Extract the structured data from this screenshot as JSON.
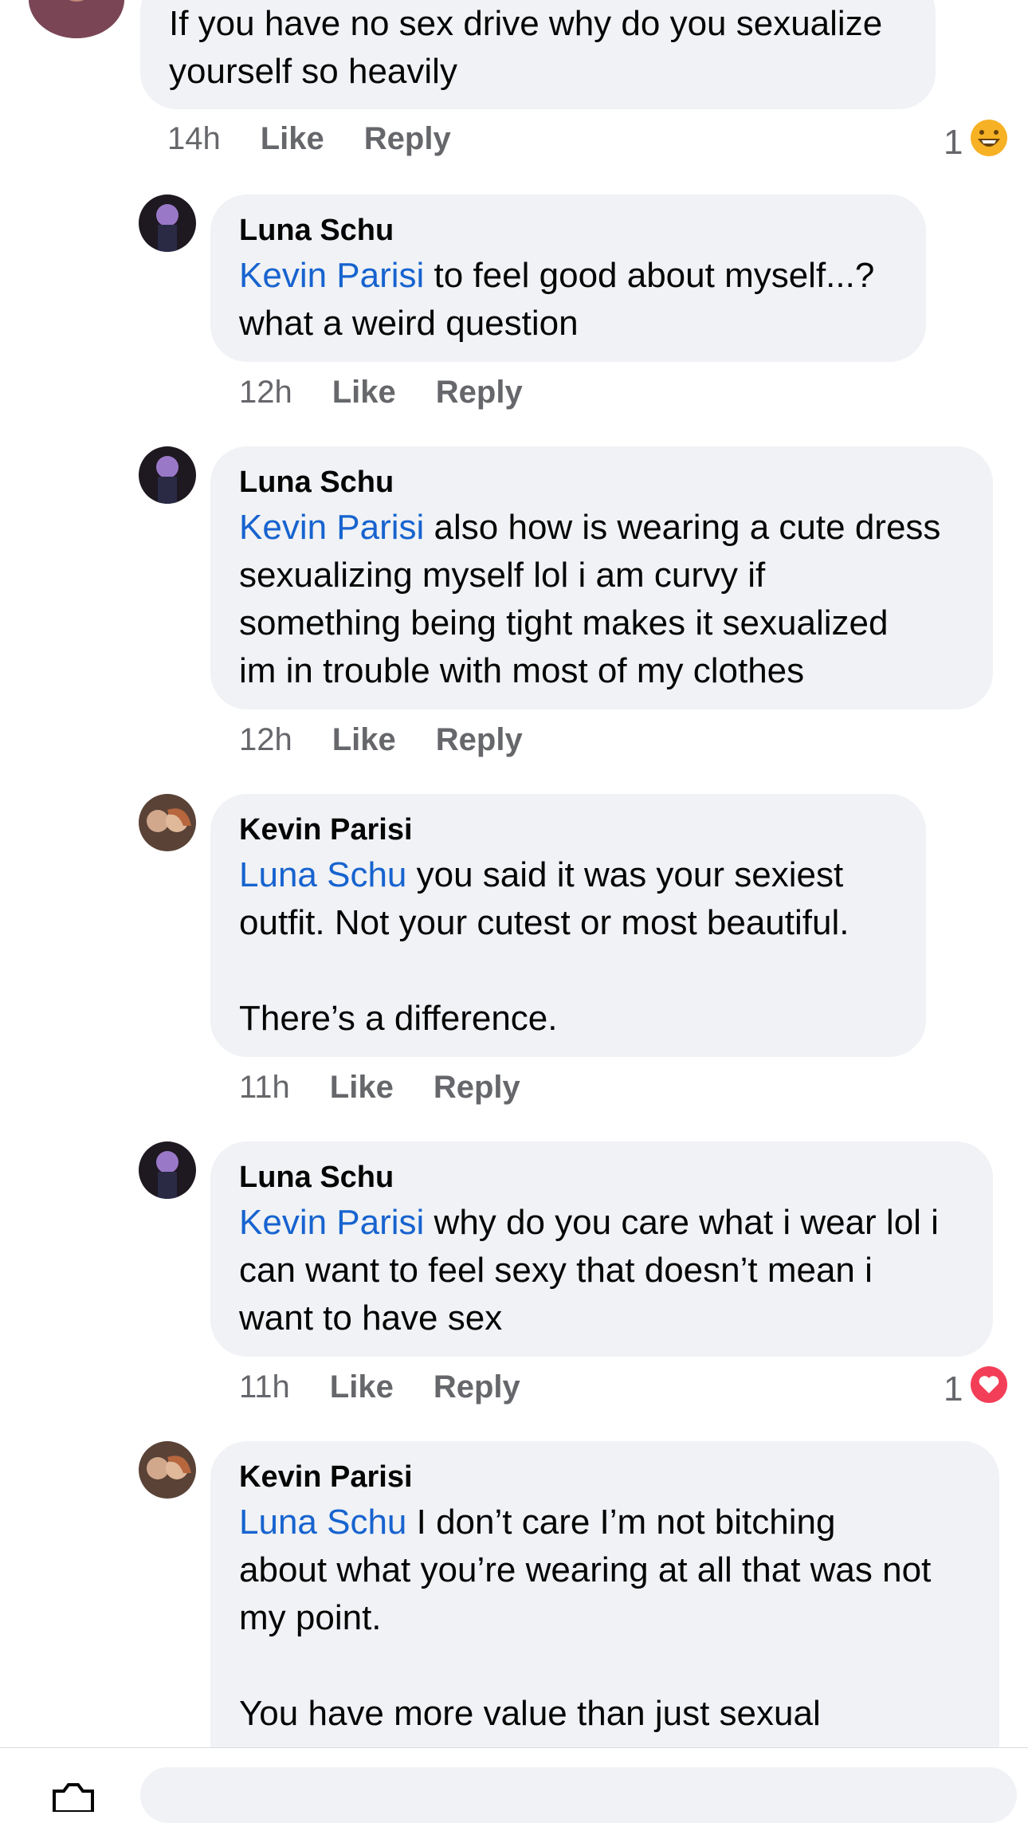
{
  "comments": [
    {
      "body": "If you have no sex drive why do you sexualize yourself so heavily",
      "time": "14h",
      "like": "Like",
      "reply": "Reply",
      "reaction_count": "1",
      "reaction_icon": "haha-icon"
    },
    {
      "author": "Luna Schu",
      "mention": "Kevin Parisi",
      "body": " to feel good about myself...?\nwhat a weird question",
      "time": "12h",
      "like": "Like",
      "reply": "Reply"
    },
    {
      "author": "Luna Schu",
      "mention": "Kevin Parisi",
      "body": " also how is wearing a cute dress\nsexualizing myself lol i am curvy if\nsomething being tight makes it sexualized\nim in trouble with most of my clothes",
      "time": "12h",
      "like": "Like",
      "reply": "Reply"
    },
    {
      "author": "Kevin Parisi",
      "mention": "Luna Schu",
      "body": " you said it was your sexiest\noutfit. Not your cutest or most beautiful.\n\nThere’s a difference.",
      "time": "11h",
      "like": "Like",
      "reply": "Reply"
    },
    {
      "author": "Luna Schu",
      "mention": "Kevin Parisi",
      "body": " why do you care what i wear lol i\ncan want to feel sexy that doesn’t mean i\nwant to have sex",
      "time": "11h",
      "like": "Like",
      "reply": "Reply",
      "reaction_count": "1",
      "reaction_icon": "love-icon"
    },
    {
      "author": "Kevin Parisi",
      "mention": "Luna Schu",
      "body": " I don’t care I’m not bitching\nabout what you’re wearing at all that was not\nmy point.\n\nYou have more value than just sexual"
    }
  ],
  "colors": {
    "mention": "#1763cf",
    "bubble": "#f0f2f5",
    "meta": "#65676b",
    "love": "#f33e58",
    "haha": "#f7b125"
  }
}
